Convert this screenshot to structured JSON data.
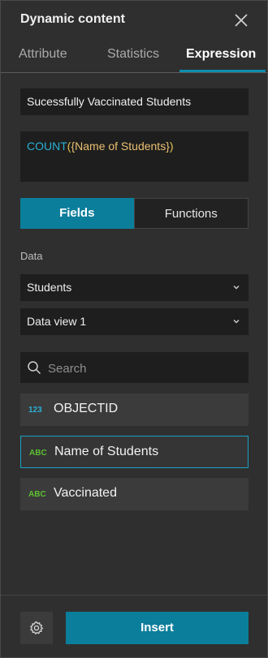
{
  "panel": {
    "title": "Dynamic content",
    "close_icon": "close-icon"
  },
  "tabs": [
    {
      "label": "Attribute",
      "active": false
    },
    {
      "label": "Statistics",
      "active": false
    },
    {
      "label": "Expression",
      "active": true
    }
  ],
  "expression": {
    "name": "Sucessfully Vaccinated Students",
    "function_name": "COUNT",
    "open_paren": "(",
    "field_token": "{Name of Students}",
    "close_paren": ")"
  },
  "segment": {
    "fields_label": "Fields",
    "functions_label": "Functions",
    "active": "Fields"
  },
  "data": {
    "label": "Data",
    "source": "Students",
    "view": "Data view 1",
    "chevron_icon": "chevron-down-icon"
  },
  "search": {
    "placeholder": "Search",
    "value": "",
    "icon": "search-icon"
  },
  "fields": [
    {
      "type": "123",
      "name": "OBJECTID",
      "selected": false
    },
    {
      "type": "ABC",
      "name": "Name of Students",
      "selected": true
    },
    {
      "type": "ABC",
      "name": "Vaccinated",
      "selected": false
    }
  ],
  "footer": {
    "settings_icon": "gear-icon",
    "insert_label": "Insert"
  },
  "colors": {
    "accent": "#0b7e9b",
    "selected_border": "#1aa0c4",
    "function_text": "#2ab0d4",
    "field_token_text": "#e8c070",
    "string_type": "#5cc030"
  }
}
